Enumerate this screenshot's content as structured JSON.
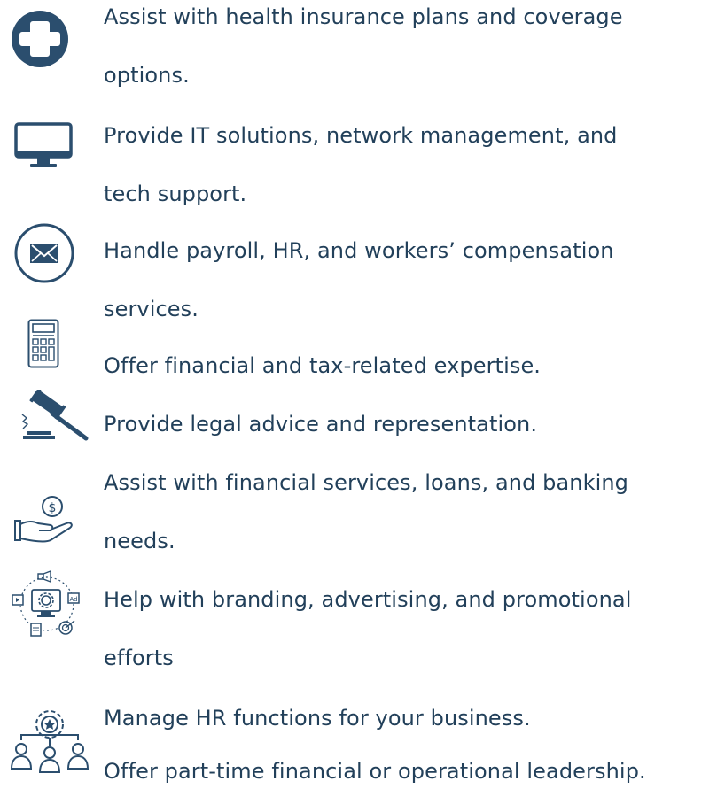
{
  "colors": {
    "icon": "#2b4e6e",
    "text": "#22405a",
    "background": "#ffffff"
  },
  "services": [
    {
      "icon": "medical-cross-icon",
      "lines": [
        "Assist with health insurance plans and coverage",
        "options."
      ]
    },
    {
      "icon": "computer-monitor-icon",
      "lines": [
        "Provide IT solutions, network management, and",
        "tech support."
      ]
    },
    {
      "icon": "envelope-icon",
      "lines": [
        "Handle payroll, HR, and workers’ compensation",
        "services."
      ]
    },
    {
      "icon": "calculator-icon",
      "lines": [
        "Offer financial and tax-related expertise."
      ]
    },
    {
      "icon": "gavel-icon",
      "lines": [
        "Provide legal advice and representation."
      ]
    },
    {
      "icon": "hand-dollar-icon",
      "lines": [
        "Assist with financial services, loans, and banking",
        "needs."
      ]
    },
    {
      "icon": "marketing-icon",
      "lines": [
        "Help with branding, advertising, and promotional",
        "efforts"
      ]
    },
    {
      "icon": "hr-management-icon",
      "lines": [
        "Manage HR functions for your business."
      ]
    },
    {
      "icon": "",
      "lines": [
        "Offer part-time financial or operational leadership."
      ]
    }
  ]
}
